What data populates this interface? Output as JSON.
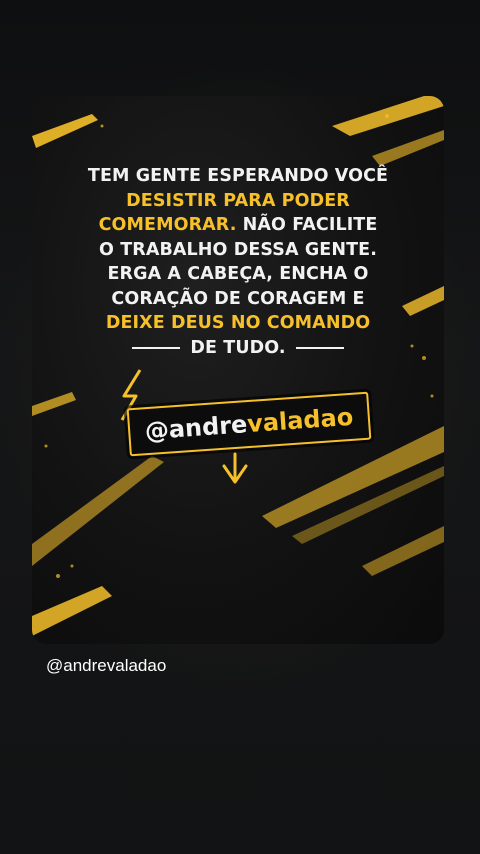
{
  "post": {
    "quote_lines": [
      [
        {
          "text": "TEM GENTE ESPERANDO VOCÊ",
          "hl": false
        }
      ],
      [
        {
          "text": "DESISTIR PARA PODER",
          "hl": true
        }
      ],
      [
        {
          "text": "COMEMORAR.",
          "hl": true
        },
        {
          "text": " NÃO FACILITE",
          "hl": false
        }
      ],
      [
        {
          "text": "O TRABALHO DESSA GENTE.",
          "hl": false
        }
      ],
      [
        {
          "text": "ERGA A CABEÇA, ENCHA O",
          "hl": false
        }
      ],
      [
        {
          "text": "CORAÇÃO DE CORAGEM E",
          "hl": false
        }
      ],
      [
        {
          "text": "DEIXE DEUS NO COMANDO",
          "hl": true
        }
      ]
    ],
    "quote_last_line": "DE TUDO.",
    "handle_prefix": "@andre",
    "handle_suffix": "valadao",
    "caption": "@andrevaladao"
  },
  "colors": {
    "accent": "#f5c02a",
    "text": "#f2f2f2",
    "background": "#121314"
  },
  "icons": [
    "lightning-bolt-icon",
    "arrow-down-icon"
  ]
}
